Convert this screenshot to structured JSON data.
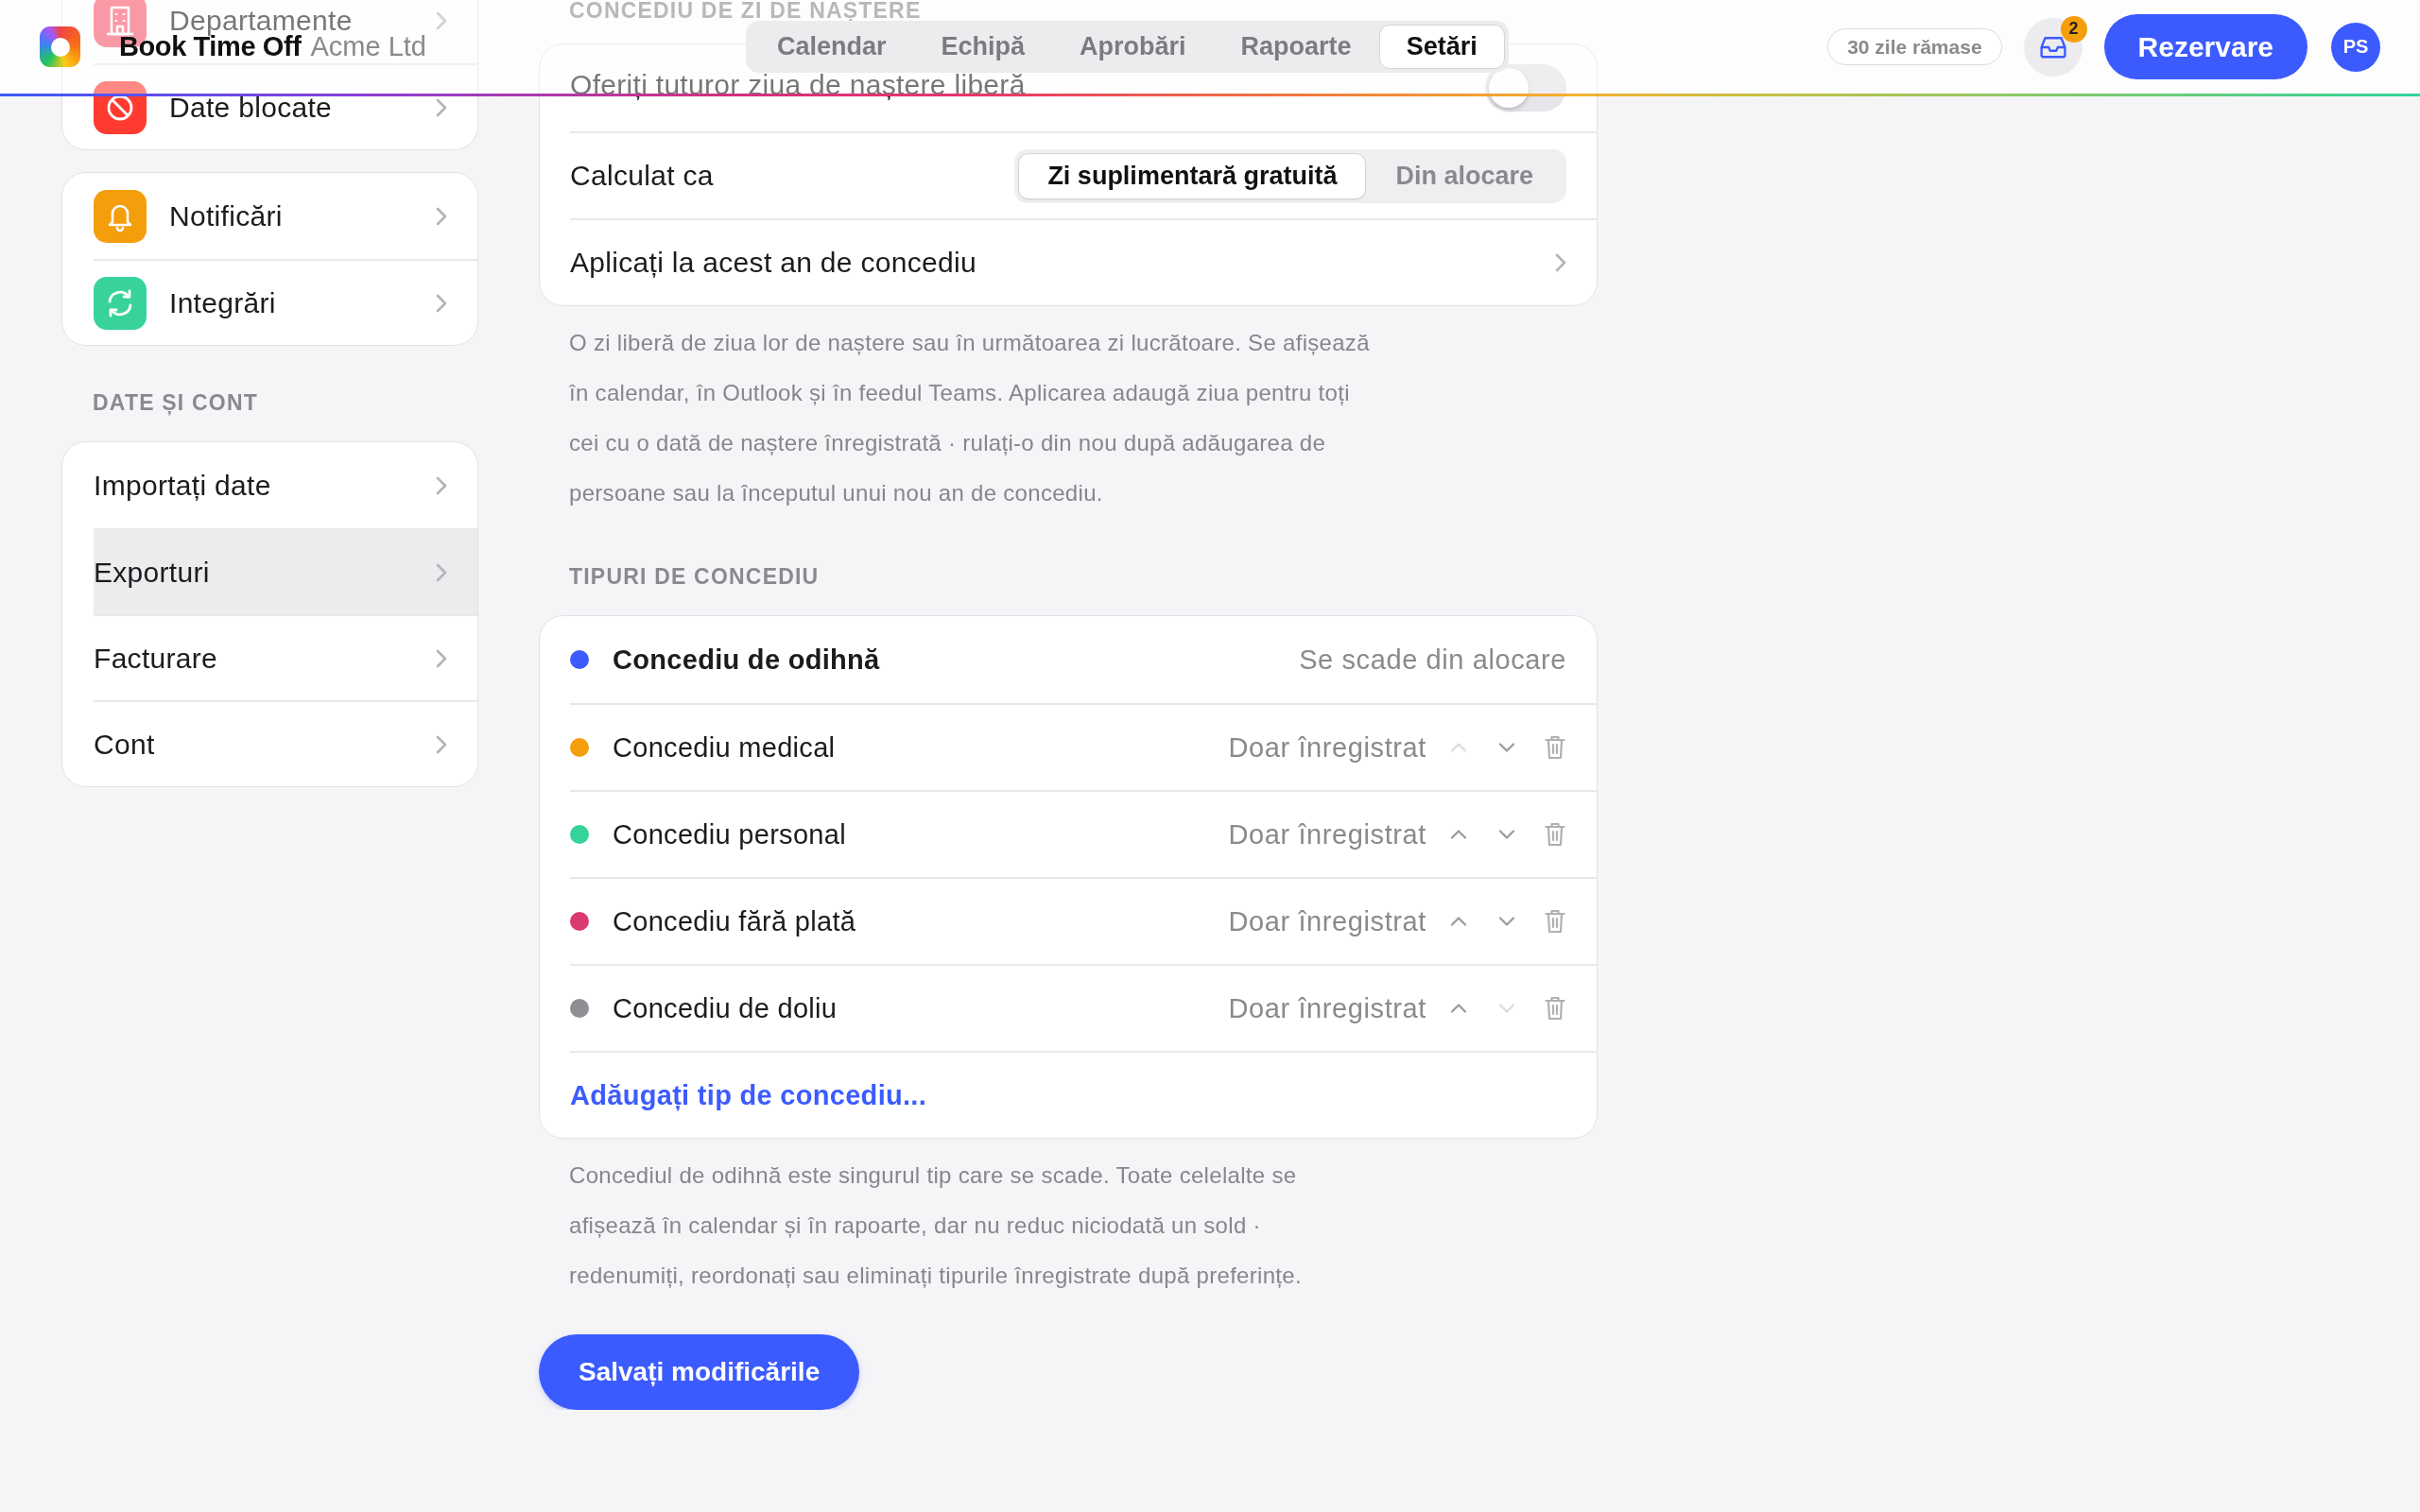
{
  "header": {
    "app_name": "Book Time Off",
    "organization": "Acme Ltd",
    "tabs": [
      {
        "label": "Calendar",
        "selected": false
      },
      {
        "label": "Echipă",
        "selected": false
      },
      {
        "label": "Aprobări",
        "selected": false
      },
      {
        "label": "Rapoarte",
        "selected": false
      },
      {
        "label": "Setări",
        "selected": true
      }
    ],
    "remaining": "30 zile rămase",
    "inbox_count": "2",
    "book_button": "Rezervare",
    "avatar": "PS"
  },
  "sidebar": {
    "groups": [
      {
        "items": [
          {
            "label": "Departamente",
            "selected": false
          },
          {
            "label": "Date blocate",
            "selected": false
          }
        ]
      },
      {
        "items": [
          {
            "label": "Notificări",
            "selected": false
          },
          {
            "label": "Integrări",
            "selected": false
          }
        ]
      },
      {
        "title": "DATE ȘI CONT",
        "items": [
          {
            "label": "Importați date",
            "selected": false
          },
          {
            "label": "Exporturi",
            "selected": true
          },
          {
            "label": "Facturare",
            "selected": false
          },
          {
            "label": "Cont",
            "selected": false
          }
        ]
      }
    ]
  },
  "birthday": {
    "title": "CONCEDIU DE ZI DE NAȘTERE",
    "rows": [
      {
        "kind": "toggle",
        "label": "Oferiți tuturor ziua de naștere liberă",
        "on": false
      },
      {
        "kind": "segmented",
        "label": "Calculat ca",
        "options": [
          {
            "label": "Zi suplimentară gratuită",
            "selected": true
          },
          {
            "label": "Din alocare",
            "selected": false
          }
        ]
      },
      {
        "kind": "link",
        "label": "Aplicați la acest an de concediu"
      }
    ],
    "note": "O zi liberă de ziua lor de naștere sau în următoarea zi lucrătoare. Se afișează în calendar, în Outlook și în feedul Teams. Aplicarea adaugă ziua pentru toți cei cu o dată de naștere înregistrată · rulați-o din nou după adăugarea de persoane sau la începutul unui nou an de concediu."
  },
  "leave_types": {
    "title": "TIPURI DE CONCEDIU",
    "items": [
      {
        "kind": "deducted",
        "name": "Concediu de odihnă",
        "color": "#3c5bff",
        "status": "Se scade din alocare"
      },
      {
        "kind": "recorded",
        "name": "Concediu medical",
        "color": "#f59e0b",
        "status": "Doar înregistrat",
        "up_disabled": true,
        "down_disabled": false
      },
      {
        "kind": "recorded",
        "name": "Concediu personal",
        "color": "#34d399",
        "status": "Doar înregistrat",
        "up_disabled": false,
        "down_disabled": false
      },
      {
        "kind": "recorded",
        "name": "Concediu fără plată",
        "color": "#db3a6e",
        "status": "Doar înregistrat",
        "up_disabled": false,
        "down_disabled": false
      },
      {
        "kind": "recorded",
        "name": "Concediu de doliu",
        "color": "#8e8e93",
        "status": "Doar înregistrat",
        "up_disabled": false,
        "down_disabled": true
      }
    ],
    "add_link": "Adăugați tip de concediu...",
    "note": "Concediul de odihnă este singurul tip care se scade. Toate celelalte se afișează în calendar și în rapoarte, dar nu reduc niciodată un sold · redenumiți, reordonați sau eliminați tipurile înregistrate după preferințe."
  },
  "save_button": "Salvați modificările"
}
